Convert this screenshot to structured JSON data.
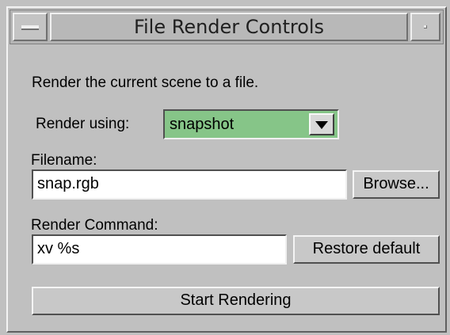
{
  "window": {
    "title": "File Render Controls"
  },
  "description": "Render the current scene to a file.",
  "render_using": {
    "label": "Render using:",
    "selected": "snapshot",
    "color": "#86c588"
  },
  "filename": {
    "label": "Filename:",
    "value": "snap.rgb",
    "browse_label": "Browse..."
  },
  "render_command": {
    "label": "Render Command:",
    "value": "xv %s",
    "restore_label": "Restore default"
  },
  "start_button_label": "Start Rendering"
}
